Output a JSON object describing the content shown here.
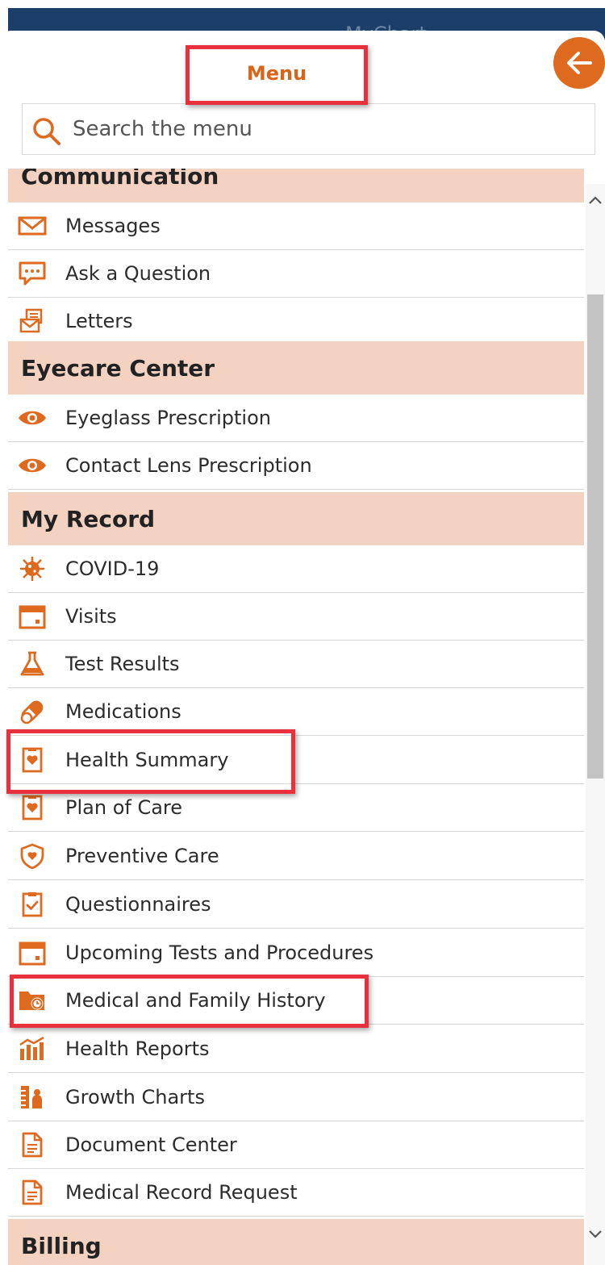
{
  "app": {
    "title": "MyChart"
  },
  "menu": {
    "title": "Menu"
  },
  "search": {
    "placeholder": "Search the menu"
  },
  "accent_color": "#dd6a1f",
  "header_background": "#f3d2c1",
  "sections": {
    "communication": {
      "title": "Communication",
      "items": [
        {
          "label": "Messages",
          "icon": "envelope-icon"
        },
        {
          "label": "Ask a Question",
          "icon": "chat-bubble-icon"
        },
        {
          "label": "Letters",
          "icon": "letter-icon"
        }
      ]
    },
    "eyecare": {
      "title": "Eyecare Center",
      "items": [
        {
          "label": "Eyeglass Prescription",
          "icon": "eye-icon"
        },
        {
          "label": "Contact Lens Prescription",
          "icon": "eye-icon"
        }
      ]
    },
    "my_record": {
      "title": "My Record",
      "items": [
        {
          "label": "COVID-19",
          "icon": "virus-icon"
        },
        {
          "label": "Visits",
          "icon": "calendar-icon"
        },
        {
          "label": "Test Results",
          "icon": "flask-icon"
        },
        {
          "label": "Medications",
          "icon": "pill-icon"
        },
        {
          "label": "Health Summary",
          "icon": "clipboard-heart-icon"
        },
        {
          "label": "Plan of Care",
          "icon": "clipboard-heart-icon"
        },
        {
          "label": "Preventive Care",
          "icon": "shield-heart-icon"
        },
        {
          "label": "Questionnaires",
          "icon": "clipboard-check-icon"
        },
        {
          "label": "Upcoming Tests and Procedures",
          "icon": "calendar-icon"
        },
        {
          "label": "Medical and Family History",
          "icon": "folder-clock-icon"
        },
        {
          "label": "Health Reports",
          "icon": "bar-chart-icon"
        },
        {
          "label": "Growth Charts",
          "icon": "growth-chart-icon"
        },
        {
          "label": "Document Center",
          "icon": "document-icon"
        },
        {
          "label": "Medical Record Request",
          "icon": "document-icon"
        }
      ]
    },
    "billing": {
      "title": "Billing"
    }
  }
}
